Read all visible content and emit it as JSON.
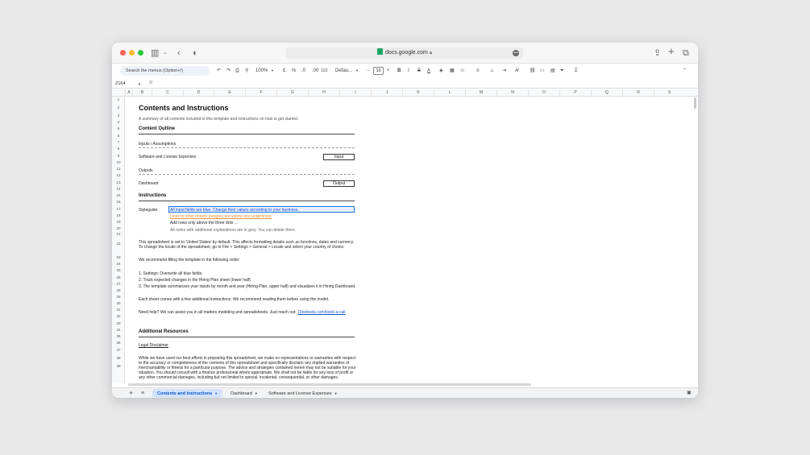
{
  "browser": {
    "url": "docs.google.com"
  },
  "toolbar": {
    "search_placeholder": "Search the menus (Option+/)",
    "zoom": "100%",
    "currency": "£",
    "percent": "%",
    "decrease_decimal": ".0",
    "increase_decimal": ".00",
    "number_format": "123",
    "font": "Defau...",
    "font_size": "10",
    "bold": "B",
    "italic": "I",
    "strike": "S",
    "text_color": "A",
    "sum": "Σ"
  },
  "formula_bar": {
    "cell_ref": "Z164",
    "fx": "fx"
  },
  "columns": [
    "A",
    "B",
    "C",
    "D",
    "E",
    "F",
    "G",
    "H",
    "I",
    "J",
    "K",
    "L",
    "M",
    "N",
    "O",
    "P",
    "Q",
    "R",
    "S"
  ],
  "rows": [
    "1",
    "2",
    "3",
    "4",
    "5",
    "6",
    "7",
    "8",
    "9",
    "10",
    "11",
    "12",
    "13",
    "14",
    "15",
    "16",
    "17",
    "18",
    "19",
    "20",
    "21",
    "22",
    "23",
    "24",
    "25",
    "26",
    "27",
    "28",
    "29",
    "30",
    "31",
    "32",
    "33",
    "34",
    "35",
    "36",
    "37",
    "38",
    "39"
  ],
  "doc": {
    "title": "Contents and Instructions",
    "subtitle": "A summary of all contents included in this template and instructions on how to get started.",
    "content_outline": "Content Outline",
    "inputs_assumptions": "Inputs / Assumptions",
    "software_license": "Software and License Expenses",
    "input_button": "Input",
    "outputs": "Outputs",
    "dashboard": "Dashboard",
    "output_button": "Output",
    "instructions": "Instructions",
    "styleguide": "Styleguide",
    "style_blue": "All input fields are blue. Change their values according to your business.",
    "style_orange": "Links to other sheets (ranges) are yellow and underlined.",
    "style_rows": "Add rows only above the three dots ...",
    "style_grey": "All notes with additional explanations are in grey. You can delete them.",
    "locale_1": "This spreadsheet is set to 'United States' by default. This affects formatting details such as functions, dates and currency.",
    "locale_2": "To change the locale of the spreadsheet, go to File > Settings > General > Locale and select your country of choice.",
    "recommend": "We recommend filling the template in the following order:",
    "step_1": "1. Settings: Overwrite all blue fields.",
    "step_2": "2. Track expected changes in the Hiring Plan sheet (lower half).",
    "step_3": "3. The template summarizes your inputs by month and year (Hiring Plan, upper half) and visualizes it in Hiring Dashboard.",
    "each_sheet": "Each sheet comes with a few additional instructions. We recommend reading them before using the model.",
    "need_help": "Need help? We can assist you in all matters modeling and spreadsheets. Just reach out:",
    "help_link": "10xsheets.com/book-a-call",
    "additional_resources": "Additional Resources",
    "legal_disclaimer": "Legal Disclaimer",
    "legal_1": "While we have used our best efforts in preparing this spreadsheet, we make no representations or warranties with respect",
    "legal_2": "to the accuracy or completeness of the contents of this spreadsheet and specifically disclaim any implied warranties of",
    "legal_3": "merchantability or fitness for a particular purpose. The advice and strategies contained herein may not be suitable for your",
    "legal_4": "situation. You should consult with a finance professional where appropriate. We shall not be liable for any loss of profit or",
    "legal_5": "any other commercial damages, including but not limited to special, incidental, consequential, or other damages."
  },
  "sheets": [
    {
      "label": "Contents and Instructions",
      "active": true
    },
    {
      "label": "Dashboard",
      "active": false
    },
    {
      "label": "Software and License Expenses",
      "active": false
    }
  ],
  "colors": {
    "input_blue": "#1a4cd6",
    "link_orange": "#e69138",
    "active_tab": "#d3e3fd"
  }
}
